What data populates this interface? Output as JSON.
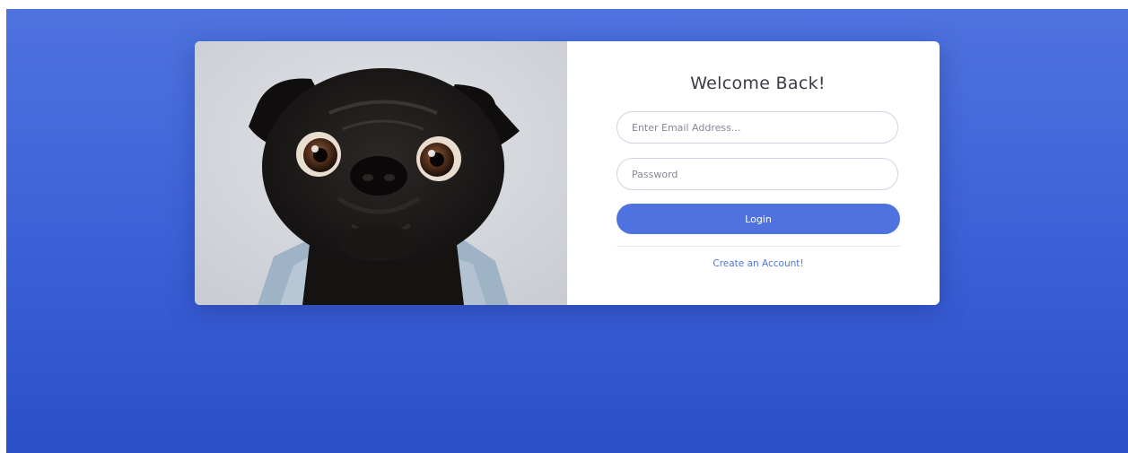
{
  "login_card": {
    "title": "Welcome Back!",
    "email_placeholder": "Enter Email Address...",
    "password_placeholder": "Password",
    "login_button": "Login",
    "create_account_link": "Create an Account!"
  },
  "photo": {
    "subject": "pug-photo"
  },
  "colors": {
    "background_top": "#4e73df",
    "background_bottom": "#2a4fc7",
    "primary": "#4e73df",
    "card": "#ffffff",
    "title_text": "#3a3b45"
  }
}
